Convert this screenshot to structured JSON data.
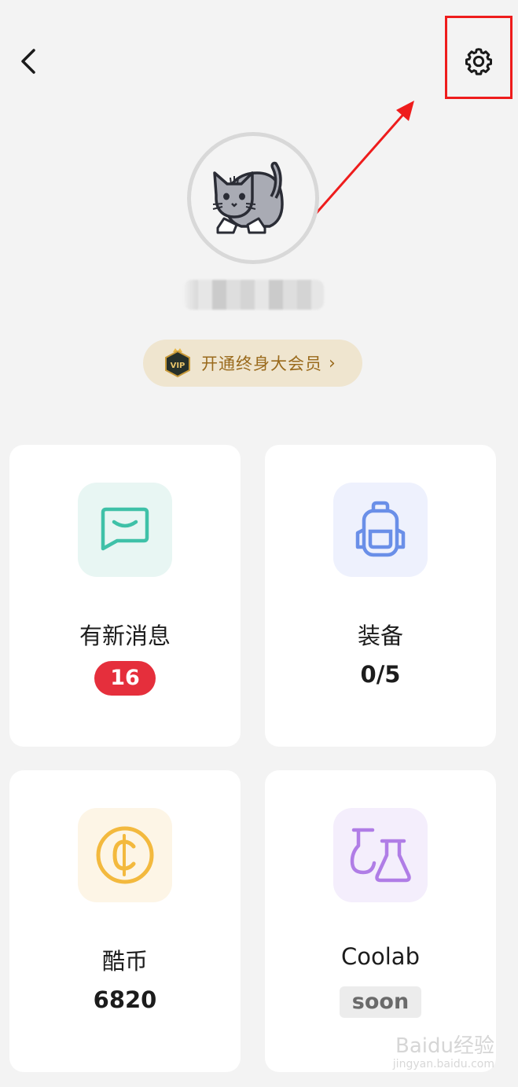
{
  "header": {
    "back_icon": "chevron-left-icon",
    "settings_icon": "gear-icon"
  },
  "profile": {
    "avatar_icon": "cat-avatar-icon",
    "username": "",
    "vip_label": "开通终身大会员",
    "vip_badge_text": "VIP"
  },
  "cards": [
    {
      "title": "有新消息",
      "value": "16",
      "icon": "message-icon",
      "accent": "#3fc1a8",
      "icon_bg": "#e8f6f3"
    },
    {
      "title": "装备",
      "value": "0/5",
      "icon": "backpack-icon",
      "accent": "#6a8fe8",
      "icon_bg": "#eef1fd"
    },
    {
      "title": "酷币",
      "value": "6820",
      "icon": "coin-icon",
      "accent": "#f3b93e",
      "icon_bg": "#fdf5e6"
    },
    {
      "title": "Coolab",
      "value": "soon",
      "icon": "flask-icon",
      "accent": "#b07de6",
      "icon_bg": "#f4eefc"
    }
  ],
  "colors": {
    "annotation_red": "#ee1c1c",
    "badge_red": "#e52f3c",
    "vip_gold": "#9a6a1c"
  },
  "watermark": {
    "brand": "Baidu经验",
    "sub": "jingyan.baidu.com"
  }
}
